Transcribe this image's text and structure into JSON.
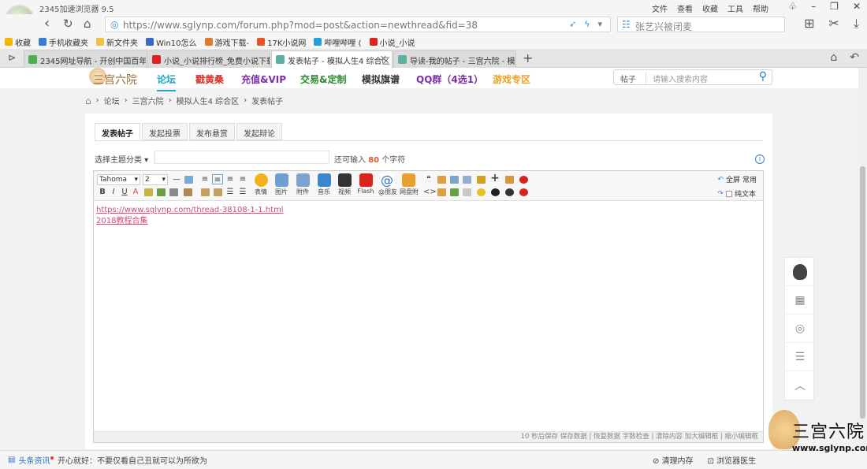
{
  "browser": {
    "app_title": "2345加速浏览器 9.5",
    "menu": [
      "文件",
      "查看",
      "收藏",
      "工具",
      "帮助"
    ],
    "url": "https://www.sglynp.com/forum.php?mod=post&action=newthread&fid=38",
    "search_text": "张艺兴被闭麦",
    "bookmarks": [
      "收藏",
      "手机收藏夹",
      "新文件夹",
      "Win10怎么",
      "游戏下载-",
      "17K小说网",
      "哔哩哔哩 (",
      "小说_小说"
    ],
    "tabs": [
      {
        "label": "2345网址导航 - 开创中国百年"
      },
      {
        "label": "小说_小说排行榜_免费小说下载"
      },
      {
        "label": "发表帖子 - 模拟人生4 综合区"
      },
      {
        "label": "导读-我的帖子 - 三宫六院 - 模"
      }
    ]
  },
  "site": {
    "logo": "三宫六院",
    "nav": [
      "论坛",
      "戳黄桑",
      "充值&VIP",
      "交易&定制",
      "模拟旗谱",
      "QQ群（4选1）",
      "游戏专区"
    ],
    "nav_colors": [
      "#20a7c9",
      "#d9342b",
      "#7b2fa8",
      "#2c8a2c",
      "#333333",
      "#7b2fa8",
      "#f0a020"
    ],
    "search_select": "帖子",
    "search_placeholder": "请输入搜索内容"
  },
  "breadcrumb": [
    "论坛",
    "三宫六院",
    "模拟人生4 综合区",
    "发表帖子"
  ],
  "post": {
    "tabs": [
      "发表帖子",
      "发起投票",
      "发布悬赏",
      "发起辩论"
    ],
    "category": "选择主题分类",
    "remain_prefix": "还可输入",
    "remain_count": "80",
    "remain_suffix": "个字符",
    "font": "Tahoma",
    "size": "2",
    "toolbar_big": [
      "表情",
      "图片",
      "附件",
      "音乐",
      "视频",
      "Flash",
      "@朋友",
      "网盘附"
    ],
    "fullscreen": "全屏",
    "common": "常用",
    "plain_text": "纯文本",
    "content": [
      "https://www.sglynp.com/thread-38108-1-1.html",
      "2018教程合集"
    ],
    "footer": "10 秒后保存 保存数据 | 恢复数据    字数检查 | 清除内容    加大编辑框 | 缩小编辑框"
  },
  "statusbar": {
    "news": "头条资讯",
    "message": "开心就好：不要仅看自己丑就可以为所欲为",
    "right": [
      "清理内存",
      "浏览器医生"
    ]
  },
  "watermark": {
    "title": "三宫六院",
    "url": "www.sglynp.com"
  }
}
